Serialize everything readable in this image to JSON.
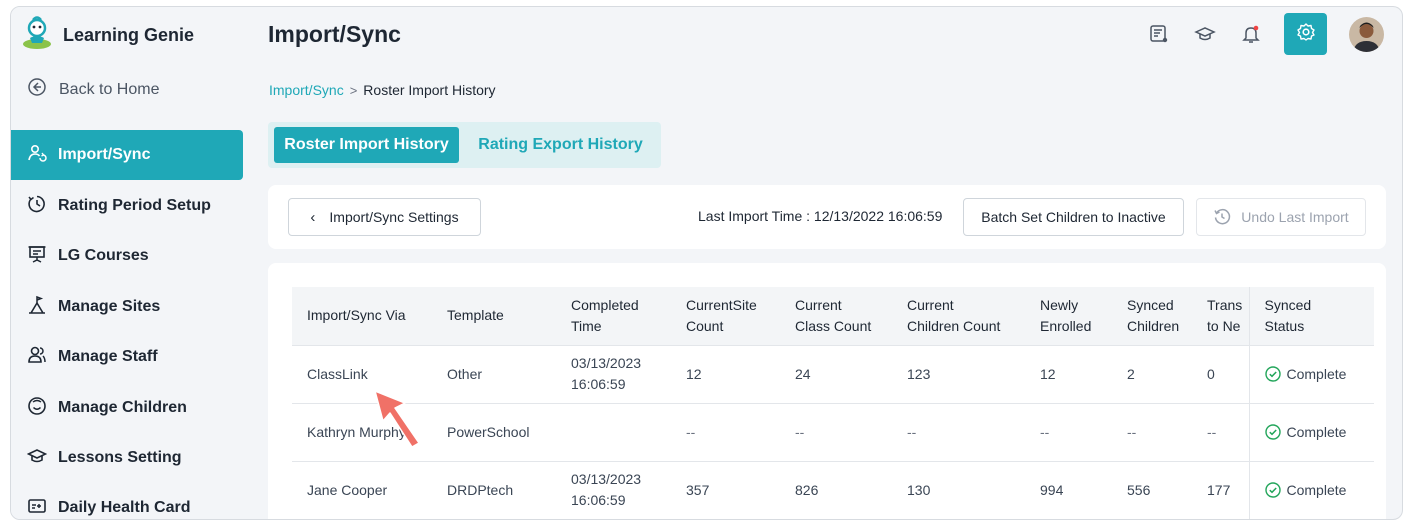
{
  "app": {
    "name": "Learning Genie"
  },
  "sidebar": {
    "back": "Back to Home",
    "items": [
      {
        "label": "Import/Sync",
        "icon": "users-sync-icon",
        "active": true
      },
      {
        "label": "Rating Period Setup",
        "icon": "clock-icon"
      },
      {
        "label": "LG Courses",
        "icon": "presentation-icon"
      },
      {
        "label": "Manage Sites",
        "icon": "building-icon"
      },
      {
        "label": "Manage Staff",
        "icon": "staff-icon"
      },
      {
        "label": "Manage Children",
        "icon": "smiley-icon"
      },
      {
        "label": "Lessons Setting",
        "icon": "graduation-cap-icon"
      },
      {
        "label": "Daily Health Card",
        "icon": "health-card-icon"
      }
    ]
  },
  "header": {
    "title": "Import/Sync",
    "icons": [
      "message-icon",
      "graduation-cap-icon",
      "bell-icon",
      "gear-icon",
      "avatar"
    ]
  },
  "breadcrumb": {
    "parent": "Import/Sync",
    "separator": ">",
    "current": "Roster Import History"
  },
  "tabs": [
    {
      "label": "Roster Import History",
      "active": true
    },
    {
      "label": "Rating Export History",
      "active": false
    }
  ],
  "toolbar": {
    "settings_label": "Import/Sync Settings",
    "last_import": "Last Import Time : 12/13/2022 16:06:59",
    "batch_label": "Batch Set Children to Inactive",
    "undo_label": "Undo Last Import"
  },
  "table": {
    "headers": [
      [
        "Import/Sync Via"
      ],
      [
        "Template"
      ],
      [
        "Completed",
        "Time"
      ],
      [
        "CurrentSite",
        "Count"
      ],
      [
        "Current",
        "Class Count"
      ],
      [
        "Current",
        "Children Count"
      ],
      [
        "Newly",
        "Enrolled"
      ],
      [
        "Synced",
        "Children"
      ],
      [
        "Trans",
        "to Ne"
      ],
      [
        "Synced",
        "Status"
      ]
    ],
    "rows": [
      {
        "via": "ClassLink",
        "template": "Other",
        "time": [
          "03/13/2023",
          "16:06:59"
        ],
        "site": "12",
        "cls": "24",
        "children": "123",
        "newly": "12",
        "synced": "2",
        "trans": "0",
        "status": "Complete"
      },
      {
        "via": "Kathryn Murphy",
        "template": "PowerSchool",
        "time": [
          "",
          ""
        ],
        "site": "--",
        "cls": "--",
        "children": "--",
        "newly": "--",
        "synced": "--",
        "trans": "--",
        "status": "Complete"
      },
      {
        "via": "Jane Cooper",
        "template": "DRDPtech",
        "time": [
          "03/13/2023",
          "16:06:59"
        ],
        "site": "357",
        "cls": "826",
        "children": "130",
        "newly": "994",
        "synced": "556",
        "trans": "177",
        "status": "Complete"
      }
    ]
  },
  "colors": {
    "accent": "#1fa8b7",
    "tab_bg": "#ddf0f2",
    "pointer": "#f07167"
  }
}
